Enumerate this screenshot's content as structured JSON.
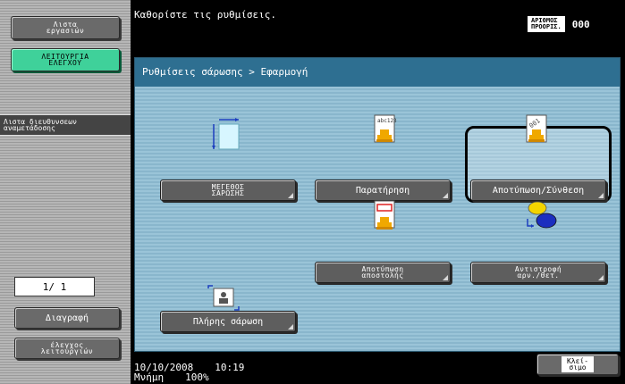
{
  "left_panel": {
    "job_list": "Λιστα\nεργασιών",
    "function_control": "ΛΕΙΤΟΥΡΓΙΑ\nΕΛΕΓΧΟΥ",
    "address_list_tab": "Λιστα διευθυνσεων\nαναμετάδοσης",
    "page_counter": "1/  1",
    "delete": "Διαγραφή",
    "check_functions": "έλεγχος\nλειτουργιών"
  },
  "header": {
    "message": "Καθορίστε τις ρυθμίσεις.",
    "destinations_label": "ΑΡΙΘΜΟΣ\nΠΡΟΟΡΙΣ.",
    "destinations_count": "000"
  },
  "main": {
    "breadcrumb": "Ρυθμίσεις σάρωσης > Εφαρμογή",
    "buttons": {
      "scan_size": "ΜΕΓΕΘΟΣ\nΣΑΡΩΣΗΣ",
      "annotation": "Παρατήρηση",
      "stamp_compose": "Αποτύπωση/Σύνθεση",
      "stamp_send": "Αποτύπωση\nαποστολής",
      "reverse_order": "Αντιστροφή\nαρν./θετ.",
      "full_scan": "Πλήρης σάρωση"
    },
    "annotation_icon_text": "abc123",
    "stamp_icon_text": "001"
  },
  "footer": {
    "date": "10/10/2008",
    "time": "10:19",
    "memory_label": "Μνήμη",
    "memory_value": "100%",
    "close": "Κλεί-\nσιμο"
  },
  "colors": {
    "panel": "#89b8cf",
    "breadcrumb": "#2e6f91",
    "active_tab": "#3fd19a"
  }
}
